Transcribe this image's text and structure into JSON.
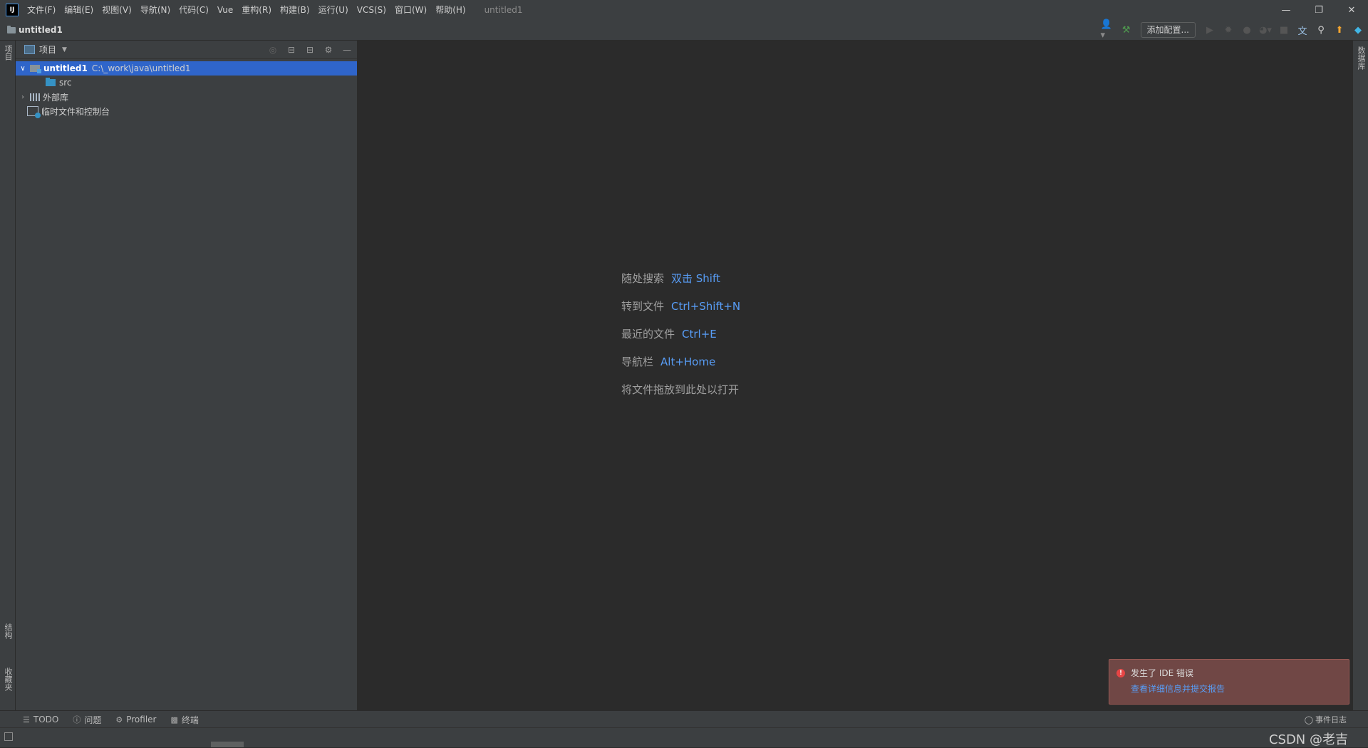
{
  "titlebar": {
    "logo": "IJ",
    "menu": [
      "文件(F)",
      "编辑(E)",
      "视图(V)",
      "导航(N)",
      "代码(C)",
      "Vue",
      "重构(R)",
      "构建(B)",
      "运行(U)",
      "VCS(S)",
      "窗口(W)",
      "帮助(H)"
    ],
    "window_title": "untitled1",
    "controls": {
      "minimize": "—",
      "restore": "❐",
      "close": "✕"
    }
  },
  "navbar": {
    "breadcrumb": "untitled1",
    "add_config_label": "添加配置...",
    "icons": [
      "user-icon",
      "hammer-icon",
      "run-icon",
      "debug-icon",
      "coverage-icon",
      "profile-icon",
      "stop-icon",
      "translate-icon",
      "search-icon",
      "update-icon",
      "plugin-icon"
    ]
  },
  "left_strip": {
    "project_tab": "项目",
    "structure_tab": "结构",
    "favorites_tab": "收藏夹"
  },
  "right_strip": {
    "database_tab": "数据库"
  },
  "project_panel": {
    "title": "项目",
    "tree": {
      "root_name": "untitled1",
      "root_path": "C:\\_work\\java\\untitled1",
      "src": "src",
      "libraries": "外部库",
      "scratches": "临时文件和控制台"
    }
  },
  "editor": {
    "hints": [
      {
        "label": "随处搜索",
        "key": "双击 Shift"
      },
      {
        "label": "转到文件",
        "key": "Ctrl+Shift+N"
      },
      {
        "label": "最近的文件",
        "key": "Ctrl+E"
      },
      {
        "label": "导航栏",
        "key": "Alt+Home"
      },
      {
        "label": "将文件拖放到此处以打开",
        "key": ""
      }
    ]
  },
  "notification": {
    "title": "发生了 IDE 错误",
    "link": "查看详细信息并提交报告"
  },
  "bottom_tabs": {
    "todo": "TODO",
    "problems": "问题",
    "profiler": "Profiler",
    "terminal": "终端",
    "event_log": "事件日志"
  },
  "status": {
    "watermark": "CSDN @老吉"
  },
  "colors": {
    "accent": "#589df6",
    "selection": "#2f65ca",
    "error": "#e64545"
  }
}
